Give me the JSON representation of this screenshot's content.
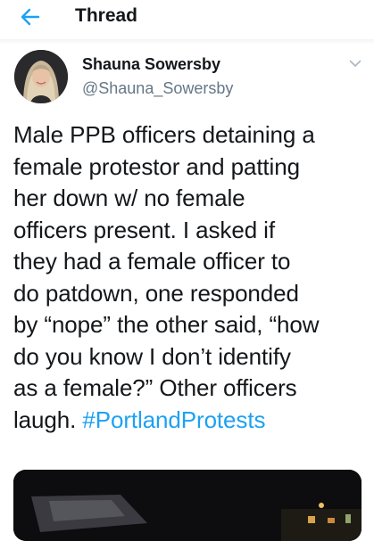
{
  "header": {
    "title": "Thread",
    "back_icon": "arrow-left-icon",
    "accent_color": "#1da1f2"
  },
  "tweet": {
    "display_name": "Shauna Sowersby",
    "handle": "@Shauna_Sowersby",
    "menu_icon": "chevron-down-icon",
    "text_lines": [
      "Male PPB officers detaining a",
      "female protestor and patting",
      "her down w/ no female",
      "officers present. I asked if",
      "they had a female officer to",
      "do patdown, one responded",
      "by “nope” the other said, “how",
      "do you know I don’t identify",
      "as a female?” Other officers"
    ],
    "last_line_text": "laugh. ",
    "hashtag": "#PortlandProtests",
    "hashtag_color": "#1da1f2",
    "media": "night-photo"
  }
}
